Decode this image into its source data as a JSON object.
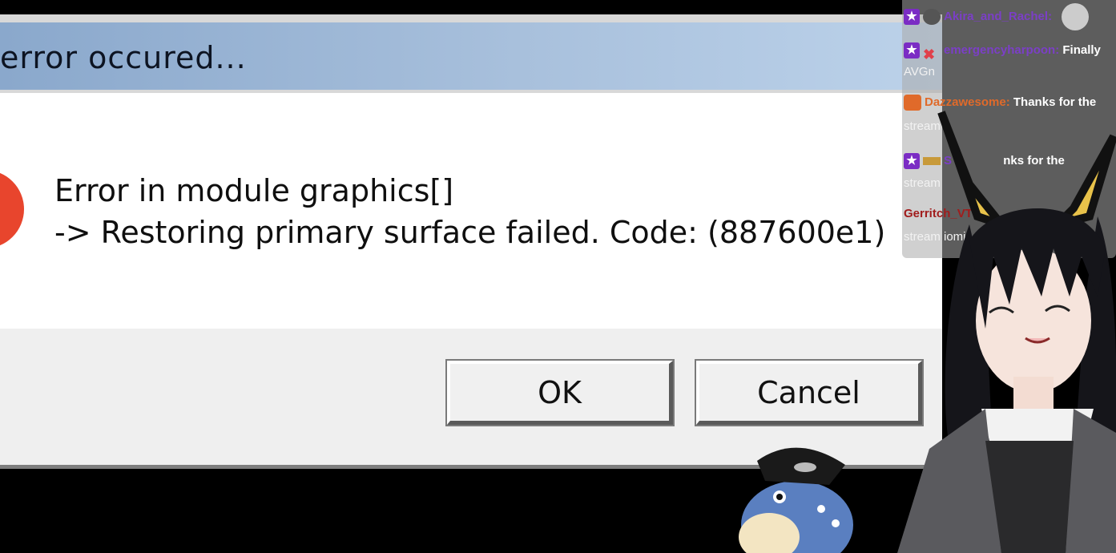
{
  "dialog": {
    "title": "error occured...",
    "message_line1": "Error in module graphics[]",
    "message_line2": "-> Restoring primary surface failed. Code: (887600e1)",
    "icon": "error-x-icon",
    "ok_label": "OK",
    "cancel_label": "Cancel"
  },
  "chat": {
    "messages": [
      {
        "user": "Akira_and_Rachel:",
        "user_color": "#7b3fc6",
        "text": ""
      },
      {
        "user": "emergencyharpoon:",
        "user_color": "#7b3fc6",
        "text": "Finally",
        "cont": "AVGn"
      },
      {
        "user": "Dazzawesome:",
        "user_color": "#e06a2a",
        "text": "Thanks for the",
        "cont": "stream"
      },
      {
        "user": "S",
        "user_color": "#7b3fc6",
        "text": "nks for the",
        "cont": "stream"
      },
      {
        "user": "Gerritch_VT",
        "user_color": "#a11c1c",
        "text": "",
        "cont": "stream iomi"
      }
    ]
  },
  "colors": {
    "titlebar": "#a8c0dc",
    "error_red": "#e8452d",
    "background": "#000000"
  }
}
